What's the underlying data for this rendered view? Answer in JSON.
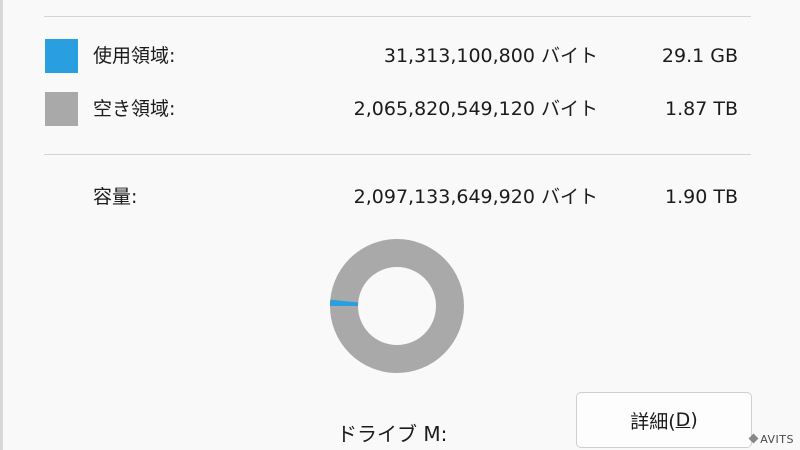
{
  "properties": {
    "used": {
      "label": "使用領域:",
      "bytes": "31,313,100,800 バイト",
      "size": "29.1 GB",
      "color": "#2a9fdf"
    },
    "free": {
      "label": "空き領域:",
      "bytes": "2,065,820,549,120 バイト",
      "size": "1.87 TB",
      "color": "#a9a9a9"
    },
    "capacity": {
      "label": "容量:",
      "bytes": "2,097,133,649,920 バイト",
      "size": "1.90 TB"
    },
    "usage_fraction": 0.0149,
    "drive_label": "ドライブ M:",
    "details_button": {
      "text": "詳細(",
      "mnemonic": "D",
      "close": ")"
    }
  },
  "watermark": "AVITS",
  "icons": {
    "used_swatch": "color-swatch",
    "free_swatch": "color-swatch",
    "watermark_logo": "logo-mark-icon"
  }
}
